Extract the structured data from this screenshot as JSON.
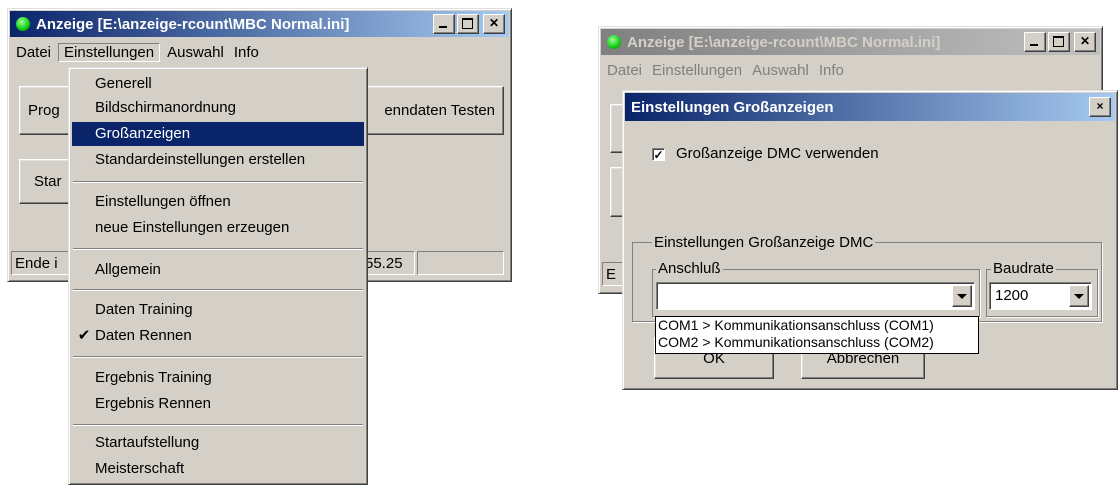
{
  "left_window": {
    "title": "Anzeige [E:\\anzeige-rcount\\MBC Normal.ini]",
    "icon": "green-dot-icon",
    "menu": [
      "Datei",
      "Einstellungen",
      "Auswahl",
      "Info"
    ],
    "buttons": {
      "prog": "Prog",
      "testen": "enndaten Testen",
      "start": "Star"
    },
    "status": {
      "left": "Ende i",
      "right": "55.25"
    }
  },
  "dropdown_menu": {
    "items": [
      {
        "label": "Generell"
      },
      {
        "label": "Bildschirmanordnung"
      },
      {
        "label": "Großanzeigen",
        "highlighted": true
      },
      {
        "label": "Standardeinstellungen erstellen"
      },
      {
        "label": "Einstellungen öffnen"
      },
      {
        "label": "neue Einstellungen erzeugen"
      },
      {
        "label": "Allgemein"
      },
      {
        "label": "Daten Training"
      },
      {
        "label": "Daten Rennen",
        "checked": true
      },
      {
        "label": "Ergebnis Training"
      },
      {
        "label": "Ergebnis Rennen"
      },
      {
        "label": "Startaufstellung"
      },
      {
        "label": "Meisterschaft"
      }
    ],
    "check_glyph": "✔"
  },
  "right_window": {
    "title": "Anzeige [E:\\anzeige-rcount\\MBC Normal.ini]",
    "menu": [
      "Datei",
      "Einstellungen",
      "Auswahl",
      "Info"
    ],
    "status_left": "E"
  },
  "dialog": {
    "title": "Einstellungen Großanzeigen",
    "close_glyph": "×",
    "checkbox_label": "Großanzeige DMC verwenden",
    "checkbox_checked": true,
    "group_label": "Einstellungen Großanzeige DMC",
    "anschluss_label": "Anschluß",
    "anschluss_value": "",
    "anschluss_options": [
      "COM1  > Kommunikationsanschluss (COM1)",
      "COM2  > Kommunikationsanschluss (COM2)"
    ],
    "baudrate_label": "Baudrate",
    "baudrate_value": "1200",
    "ok_label": "OK",
    "cancel_label": "Abbrechen"
  },
  "colors": {
    "active_title": "#0a246a",
    "inactive_title": "#808080",
    "face": "#d4d0c8",
    "highlight": "#0a246a",
    "green_icon": "#22cc22"
  }
}
